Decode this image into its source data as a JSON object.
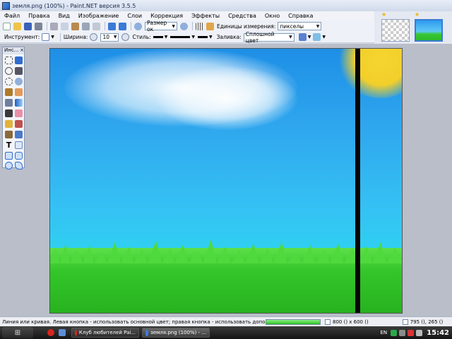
{
  "window": {
    "title": "земля.png (100%) - Paint.NET версия 3.5.5"
  },
  "menu": [
    "Файл",
    "Правка",
    "Вид",
    "Изображение",
    "Слои",
    "Коррекция",
    "Эффекты",
    "Средства",
    "Окно",
    "Справка"
  ],
  "toolbar1": {
    "zoom_value": "Размер ок",
    "units_label": "Единицы измерения:",
    "units_value": "пикселы"
  },
  "toolbar2": {
    "tool_label": "Инструмент:",
    "width_label": "Ширина:",
    "width_value": "10",
    "style_label": "Стиль:",
    "fill_label": "Заливка:",
    "fill_value": "Сплошной цвет"
  },
  "toolbox": {
    "title": "Инс..."
  },
  "status": {
    "hint": "Линия или кривая. Левая кнопка - использовать основной цвет; правая кнопка - использовать дополнительн",
    "progress_fraction": 1.0,
    "image_size": "800 () x 600 ()",
    "cursor_pos": "795 (), 265 ()"
  },
  "taskbar": {
    "tasks": [
      "Клуб любителей Pai...",
      "земля.png (100%) - ..."
    ],
    "lang": "EN",
    "time": "15:42"
  },
  "colors": {
    "sky_top": "#1e8fe6",
    "sky_bottom": "#2ed1f0",
    "grass": "#34c62a",
    "sun": "#f2cf2a",
    "pole": "#050505"
  }
}
